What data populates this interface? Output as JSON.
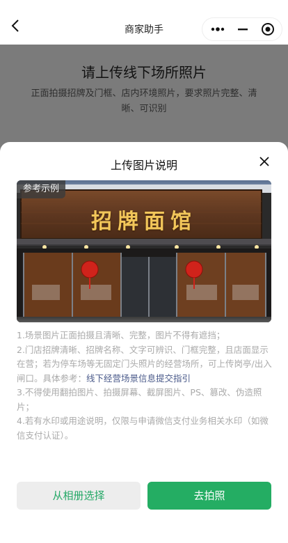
{
  "nav": {
    "title": "商家助手",
    "back_icon": "chevron-left-icon",
    "capsule": {
      "more_icon": "more-dots-icon",
      "minimize_icon": "minimize-icon",
      "close_icon": "target-close-icon"
    }
  },
  "background": {
    "title": "请上传线下场所照片",
    "subtitle": "正面拍摄招牌及门框、店内环境照片，要求照片完整、清晰、可识别"
  },
  "sheet": {
    "title": "上传图片说明",
    "close_icon": "close-icon",
    "sample_tag": "参考示例",
    "sample_sign_text": "招牌面馆",
    "notes": {
      "line1": "1.场景图片正面拍摄且清晰、完整，图片不得有遮挡；",
      "line2_text": "2.门店招牌清晰、招牌名称、文字可辨识、门框完整，且店面显示在营；若为停车场等无固定门头照片的经营场所，可上传岗亭/出入闸口。具体参考：",
      "line2_link": "线下经营场景信息提交指引",
      "line3": "3.不得使用翻拍图片、拍摄屏幕、截屏图片、PS、篡改、伪造照片；",
      "line4": "4.若有水印或用途说明，仅限与申请微信支付业务相关水印（如微信支付认证）。"
    },
    "buttons": {
      "album": "从相册选择",
      "camera": "去拍照"
    }
  },
  "colors": {
    "primary_green": "#24ad63",
    "overlay": "#7b7b7b",
    "link": "#4a5a8a"
  }
}
